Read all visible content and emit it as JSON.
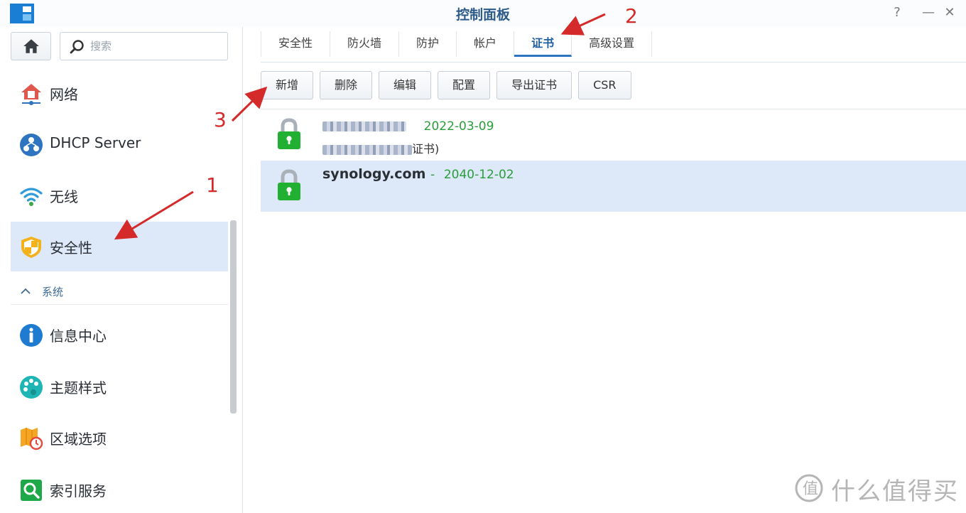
{
  "window": {
    "title": "控制面板",
    "help": "?",
    "minimize": "—",
    "close": "✕"
  },
  "sidebar": {
    "search_placeholder": "搜索",
    "items": [
      {
        "label": "网络",
        "icon": "network-icon"
      },
      {
        "label": "DHCP Server",
        "icon": "dhcp-icon"
      },
      {
        "label": "无线",
        "icon": "wifi-icon"
      },
      {
        "label": "安全性",
        "icon": "security-shield-icon",
        "active": true
      },
      {
        "label": "信息中心",
        "icon": "info-icon"
      },
      {
        "label": "主题样式",
        "icon": "palette-icon"
      },
      {
        "label": "区域选项",
        "icon": "regional-icon"
      },
      {
        "label": "索引服务",
        "icon": "index-icon"
      }
    ],
    "section": {
      "label": "系统"
    }
  },
  "tabs": [
    {
      "label": "安全性"
    },
    {
      "label": "防火墙"
    },
    {
      "label": "防护"
    },
    {
      "label": "帐户"
    },
    {
      "label": "证书",
      "active": true
    },
    {
      "label": "高级设置"
    }
  ],
  "toolbar": {
    "add": "新增",
    "delete": "删除",
    "edit": "编辑",
    "configure": "配置",
    "export": "导出证书",
    "csr": "CSR"
  },
  "certificates": [
    {
      "name": "",
      "date": "2022-03-09",
      "subtitle_suffix": "证书)",
      "selected": false
    },
    {
      "name": "synology.com",
      "sep": "-",
      "date": "2040-12-02",
      "selected": true
    }
  ],
  "annotations": {
    "n1": "1",
    "n2": "2",
    "n3": "3"
  },
  "watermark": "什么值得买",
  "colors": {
    "accent": "#2f74c0",
    "selection": "#dde9f8",
    "date_green": "#2a9d3a",
    "annotation_red": "#d42a2a"
  }
}
